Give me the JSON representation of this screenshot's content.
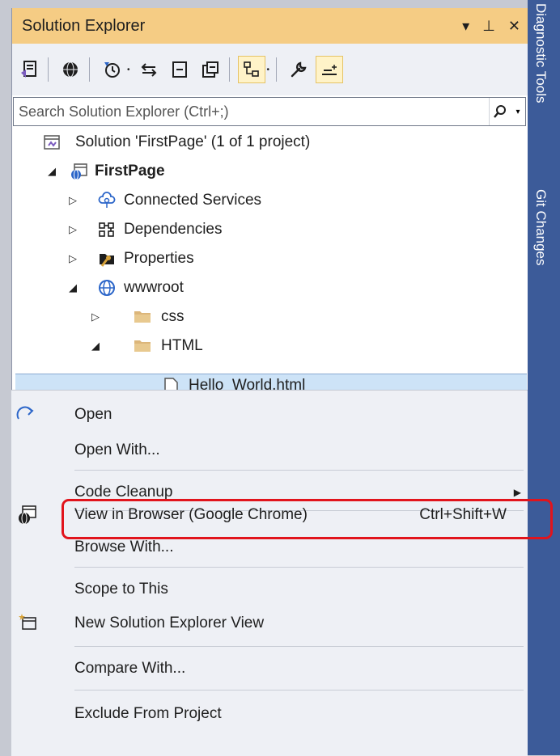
{
  "panel": {
    "title": "Solution Explorer",
    "controls": [
      "▾",
      "⊥",
      "✕"
    ]
  },
  "search": {
    "placeholder": "Search Solution Explorer (Ctrl+;)"
  },
  "tree": {
    "solution": "Solution 'FirstPage' (1 of 1 project)",
    "project": "FirstPage",
    "connected_services": "Connected Services",
    "dependencies": "Dependencies",
    "properties": "Properties",
    "wwwroot": "wwwroot",
    "css": "css",
    "html": "HTML",
    "hello_world": "Hello_World.html"
  },
  "side_tabs": {
    "diagnostic": "Diagnostic Tools",
    "git": "Git Changes"
  },
  "menu": {
    "open": "Open",
    "open_with": "Open With...",
    "code_cleanup": "Code Cleanup",
    "view_in_browser": "View in Browser (Google Chrome)",
    "view_in_browser_shortcut": "Ctrl+Shift+W",
    "browse_with": "Browse With...",
    "scope_to_this": "Scope to This",
    "new_se_view": "New Solution Explorer View",
    "compare_with": "Compare With...",
    "exclude": "Exclude From Project"
  },
  "colors": {
    "header": "#f5cc84",
    "accent": "#3c5b99",
    "highlight": "#e1141c",
    "selection": "#cde3f7"
  }
}
